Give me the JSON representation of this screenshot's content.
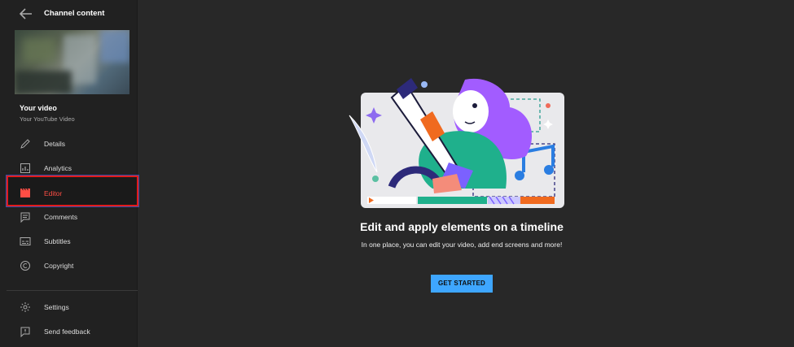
{
  "sidebar": {
    "title": "Channel content",
    "video": {
      "title": "Your video",
      "subtitle": "Your YouTube Video"
    },
    "items": [
      {
        "label": "Details",
        "icon": "pencil-icon"
      },
      {
        "label": "Analytics",
        "icon": "analytics-icon"
      },
      {
        "label": "Editor",
        "icon": "clapperboard-icon",
        "active": true
      },
      {
        "label": "Comments",
        "icon": "comments-icon"
      },
      {
        "label": "Subtitles",
        "icon": "subtitles-icon"
      },
      {
        "label": "Copyright",
        "icon": "copyright-icon"
      }
    ],
    "footer": [
      {
        "label": "Settings",
        "icon": "gear-icon"
      },
      {
        "label": "Send feedback",
        "icon": "feedback-icon"
      }
    ]
  },
  "main": {
    "headline": "Edit and apply elements on a timeline",
    "subline": "In one place, you can edit your video, add end screens and more!",
    "cta_label": "GET STARTED"
  },
  "colors": {
    "accent": "#3ea6ff",
    "active_text": "#ff4e45",
    "highlight_border": "#e21b1b",
    "background": "#282828",
    "sidebar": "#212121"
  }
}
